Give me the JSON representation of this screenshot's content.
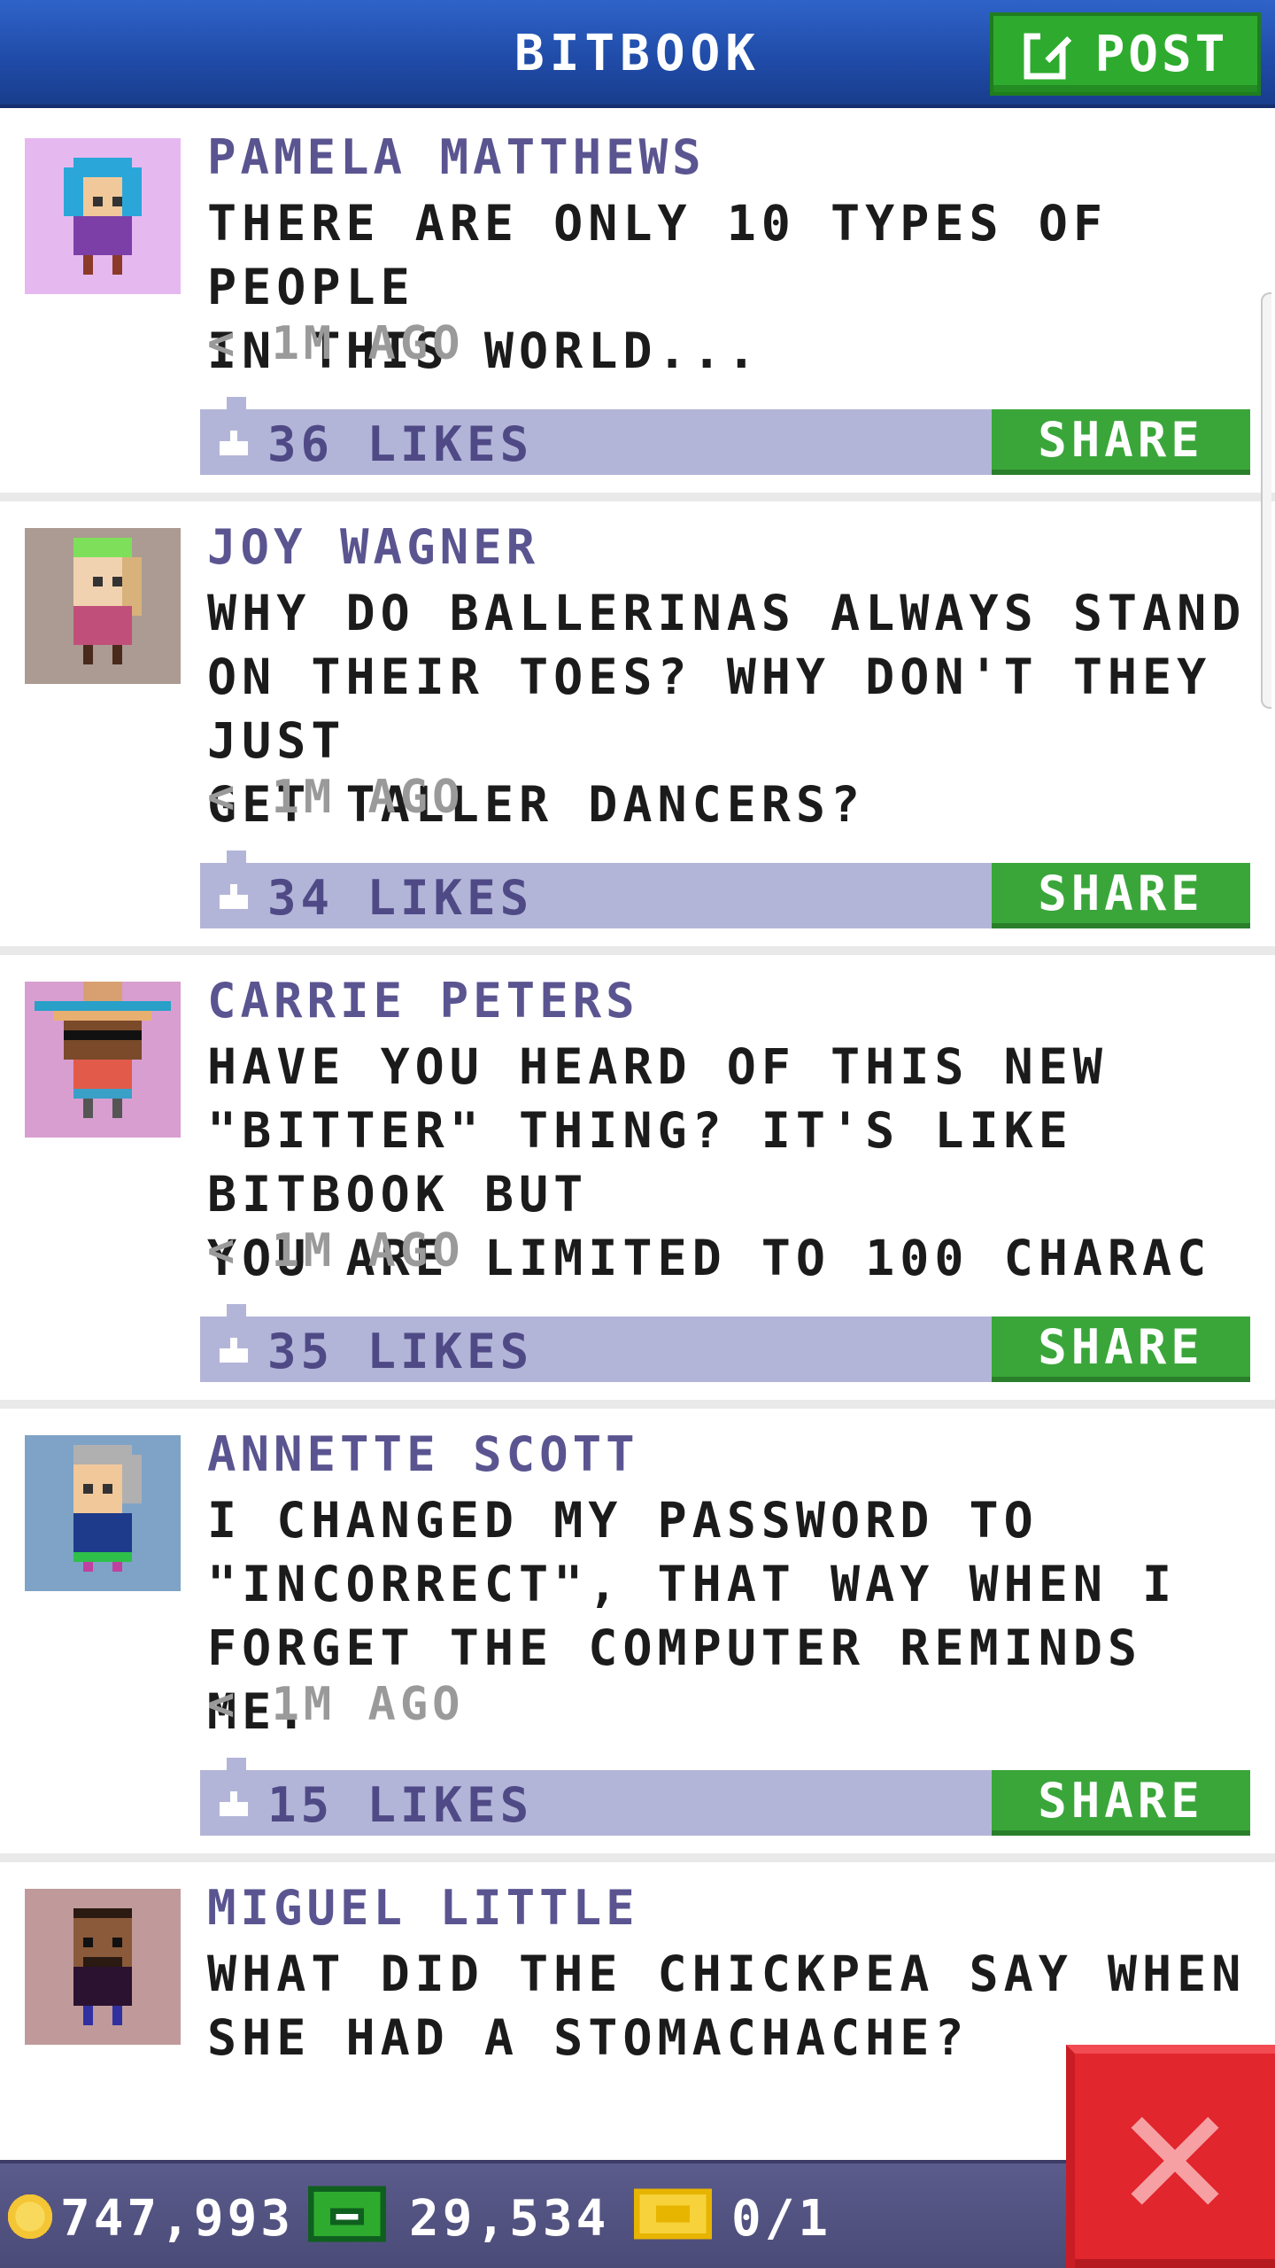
{
  "header": {
    "title": "BITBOOK",
    "post_label": "POST"
  },
  "posts": [
    {
      "author": "PAMELA MATTHEWS",
      "text": "THERE ARE ONLY 10 TYPES OF PEOPLE\nIN THIS WORLD...",
      "time": "< 1M AGO",
      "likes": "36 LIKES",
      "share_label": "SHARE"
    },
    {
      "author": "JOY WAGNER",
      "text": "WHY DO BALLERINAS ALWAYS STAND\nON THEIR TOES? WHY DON'T THEY JUST\nGET TALLER DANCERS?",
      "time": "< 1M AGO",
      "likes": "34 LIKES",
      "share_label": "SHARE"
    },
    {
      "author": "CARRIE PETERS",
      "text": "HAVE YOU HEARD OF THIS NEW\n\"BITTER\" THING? IT'S LIKE BITBOOK BUT\nYOU ARE LIMITED TO 100 CHARAC",
      "time": "< 1M AGO",
      "likes": "35 LIKES",
      "share_label": "SHARE"
    },
    {
      "author": "ANNETTE SCOTT",
      "text": "I CHANGED MY PASSWORD TO\n\"INCORRECT\", THAT WAY WHEN I\nFORGET THE COMPUTER REMINDS ME.",
      "time": "< 1M AGO",
      "likes": "15 LIKES",
      "share_label": "SHARE"
    },
    {
      "author": "MIGUEL LITTLE",
      "text": "WHAT DID THE CHICKPEA SAY WHEN\nSHE HAD A STOMACHACHE?",
      "time": "",
      "likes": "",
      "share_label": ""
    }
  ],
  "footer": {
    "coins": "747,993",
    "bux": "29,534",
    "tickets": "0/1"
  },
  "colors": {
    "header": "#1f4aa6",
    "post_button": "#2eab2e",
    "likes_bar": "#b3b5d8",
    "share_button": "#3aa63a",
    "author": "#5a5590",
    "close_button": "#e2262e",
    "footer": "#4b4b78"
  },
  "icons": {
    "post": "edit-icon",
    "like": "thumbs-up-icon",
    "time": "chevron-left-icon",
    "coin": "coin-icon",
    "bux": "cash-icon",
    "tickets": "ticket-icon",
    "close": "close-icon"
  }
}
